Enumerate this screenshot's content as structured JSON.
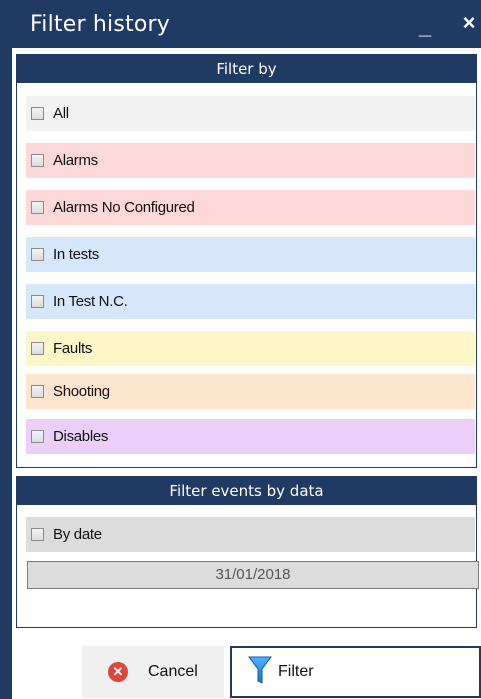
{
  "window": {
    "title": "Filter history",
    "minimize": "_",
    "close": "×"
  },
  "filter_by": {
    "header": "Filter by",
    "items": [
      {
        "label": "All",
        "color": "#f2f2f2"
      },
      {
        "label": "Alarms",
        "color": "#fcd8d8"
      },
      {
        "label": "Alarms No Configured",
        "color": "#fcd8d8"
      },
      {
        "label": "In tests",
        "color": "#d6e6fb"
      },
      {
        "label": "In Test N.C.",
        "color": "#d6e6fb"
      },
      {
        "label": "Faults",
        "color": "#fdf7c8"
      },
      {
        "label": "Shooting",
        "color": "#fde4cc"
      },
      {
        "label": "Disables",
        "color": "#eccff8"
      }
    ]
  },
  "filter_events": {
    "header": "Filter events by data",
    "by_date_label": "By date",
    "by_date_color": "#dcdcdc",
    "date_value": "31/01/2018"
  },
  "buttons": {
    "cancel": "Cancel",
    "filter": "Filter"
  }
}
